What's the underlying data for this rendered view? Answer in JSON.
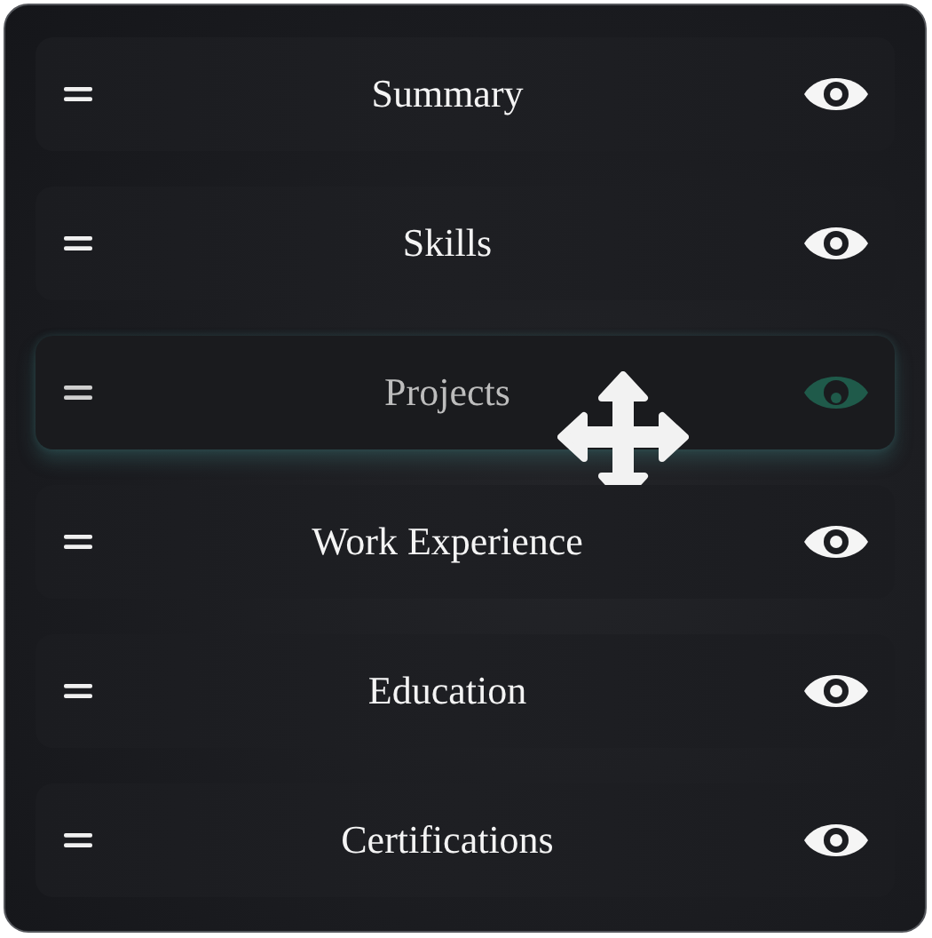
{
  "sections": [
    {
      "label": "Summary",
      "dragging": false
    },
    {
      "label": "Skills",
      "dragging": false
    },
    {
      "label": "Projects",
      "dragging": true
    },
    {
      "label": "Work Experience",
      "dragging": false
    },
    {
      "label": "Education",
      "dragging": false
    },
    {
      "label": "Certifications",
      "dragging": false
    }
  ]
}
